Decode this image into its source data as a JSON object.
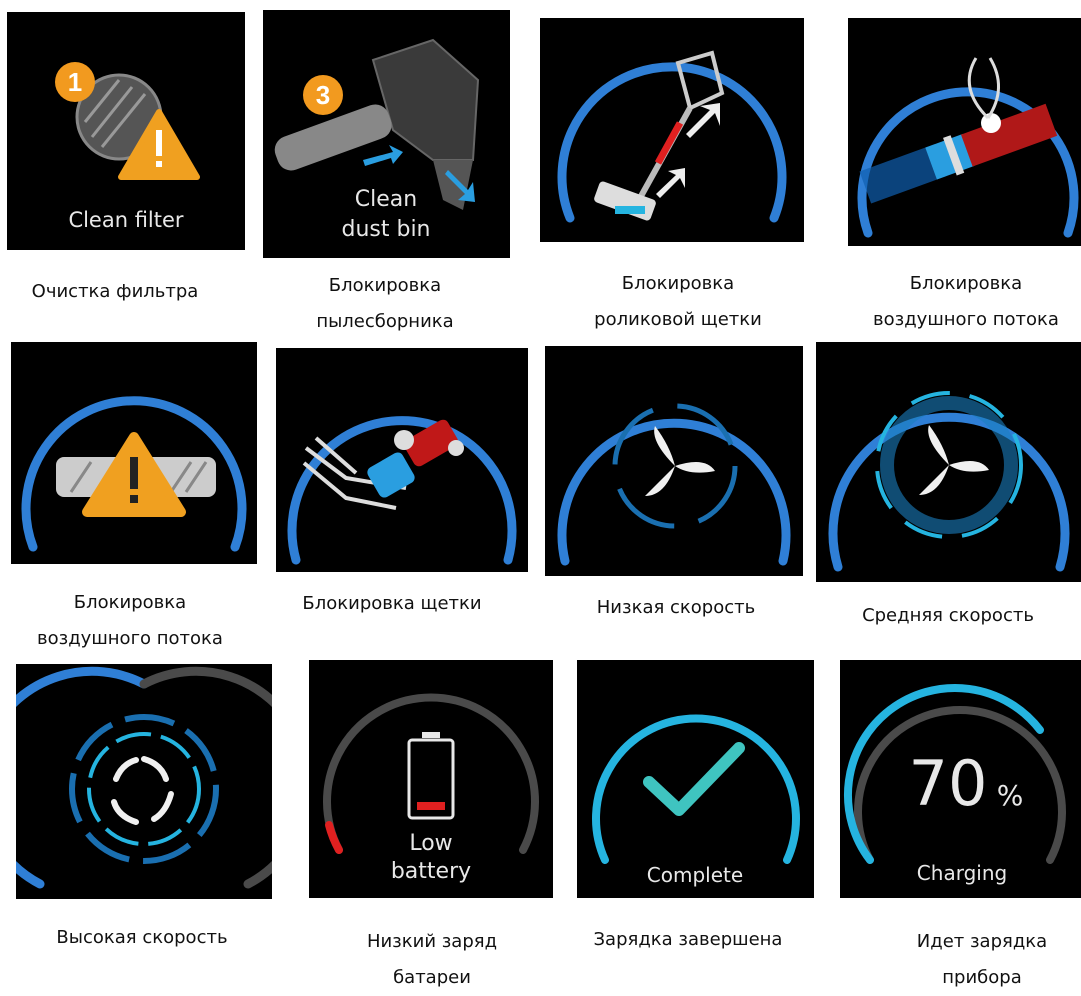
{
  "icons": [
    {
      "screen_text": "Clean filter",
      "badge": "1",
      "caption": [
        "Очистка фильтра"
      ]
    },
    {
      "screen_text": [
        "Clean",
        "dust bin"
      ],
      "badge": "3",
      "caption": [
        "Блокировка",
        "пылесборника"
      ]
    },
    {
      "caption": [
        "Блокировка",
        "роликовой щетки"
      ]
    },
    {
      "caption": [
        "Блокировка",
        "воздушного потока"
      ]
    },
    {
      "caption": [
        "Блокировка",
        "воздушного потока"
      ]
    },
    {
      "caption": [
        "Блокировка щетки"
      ]
    },
    {
      "caption": [
        "Низкая скорость"
      ]
    },
    {
      "caption": [
        "Средняя скорость"
      ]
    },
    {
      "caption": [
        "Высокая скорость"
      ]
    },
    {
      "screen_text": [
        "Low",
        "battery"
      ],
      "caption": [
        "Низкий заряд",
        "батареи"
      ]
    },
    {
      "screen_text": "Complete",
      "caption": [
        "Зарядка завершена"
      ]
    },
    {
      "screen_text": "Charging",
      "value": "70",
      "unit": "%",
      "caption": [
        "Идет зарядка",
        "прибора"
      ]
    }
  ],
  "colors": {
    "ring_blue": "#2f7fd6",
    "ring_cyan": "#25b4e0",
    "warning_orange": "#f0a020",
    "alert_red": "#e02020",
    "check_teal": "#3fc4c0",
    "grey_arc": "#4a4a4a"
  }
}
